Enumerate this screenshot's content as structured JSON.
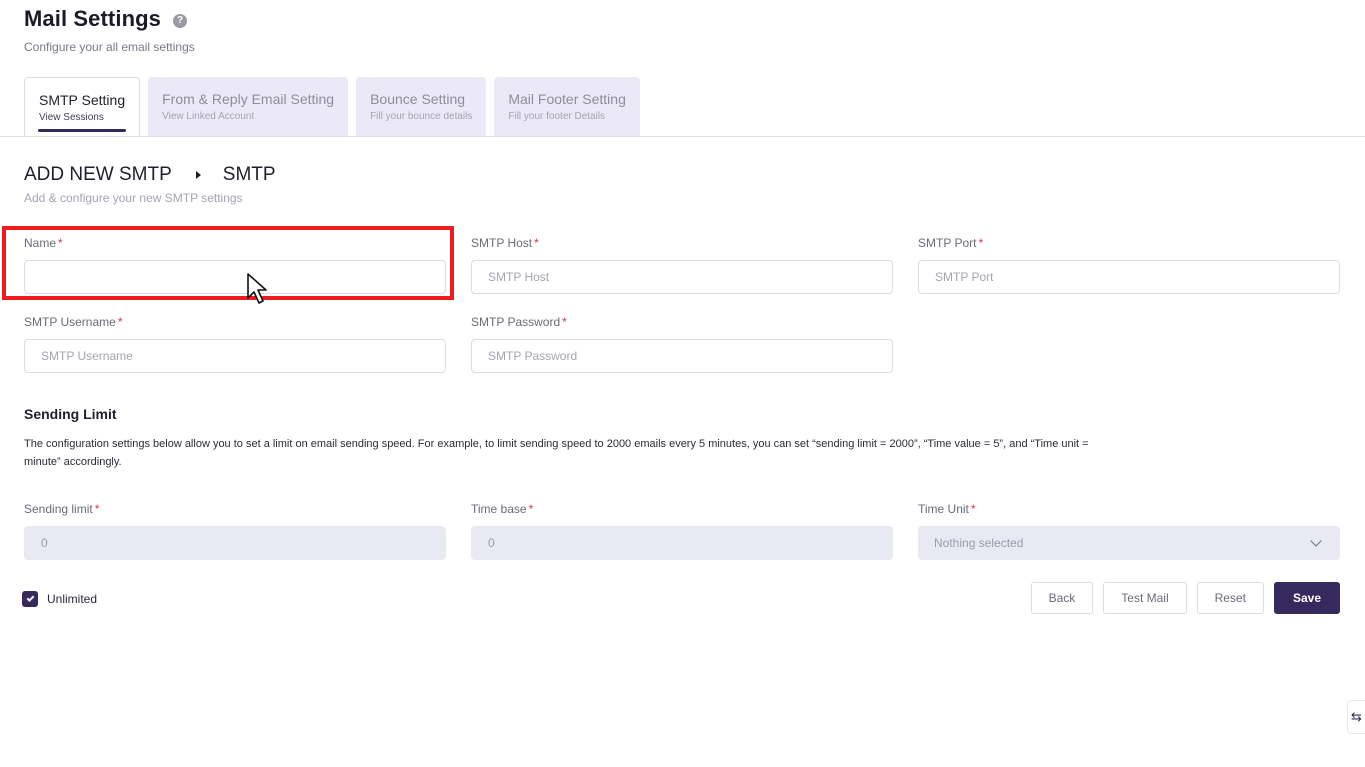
{
  "header": {
    "title": "Mail Settings",
    "help_icon": "?",
    "subtitle": "Configure your all email settings"
  },
  "tabs": [
    {
      "label": "SMTP Setting",
      "sub": "View Sessions",
      "active": true
    },
    {
      "label": "From & Reply Email Setting",
      "sub": "View Linked Account",
      "active": false
    },
    {
      "label": "Bounce Setting",
      "sub": "Fill your bounce details",
      "active": false
    },
    {
      "label": "Mail Footer Setting",
      "sub": "Fill your footer Details",
      "active": false
    }
  ],
  "section": {
    "crumb_1": "ADD NEW SMTP",
    "crumb_2": "SMTP",
    "subtitle": "Add & configure your new SMTP settings"
  },
  "form": {
    "name": {
      "label": "Name",
      "value": "",
      "placeholder": ""
    },
    "smtp_host": {
      "label": "SMTP Host",
      "value": "",
      "placeholder": "SMTP Host"
    },
    "smtp_port": {
      "label": "SMTP Port",
      "value": "",
      "placeholder": "SMTP Port"
    },
    "smtp_username": {
      "label": "SMTP Username",
      "value": "",
      "placeholder": "SMTP Username"
    },
    "smtp_password": {
      "label": "SMTP Password",
      "value": "",
      "placeholder": "SMTP Password"
    },
    "required_mark": "*"
  },
  "sending_limit": {
    "title": "Sending Limit",
    "description": "The configuration settings below allow you to set a limit on email sending speed. For example, to limit sending speed to 2000 emails every 5 minutes, you can set “sending limit = 2000”, “Time value = 5”, and “Time unit = minute” accordingly.",
    "limit": {
      "label": "Sending limit",
      "value": "0"
    },
    "time_base": {
      "label": "Time base",
      "value": "0"
    },
    "time_unit": {
      "label": "Time Unit",
      "value": "Nothing selected"
    },
    "unlimited": {
      "label": "Unlimited",
      "checked": true
    }
  },
  "buttons": {
    "back": "Back",
    "test_mail": "Test Mail",
    "reset": "Reset",
    "save": "Save"
  },
  "side_handle_glyph": "⇆",
  "colors": {
    "primary": "#35295e",
    "tab_inactive_bg": "#ece9f7",
    "required": "#e0324b",
    "highlight": "#ee1c1c",
    "disabled_input_bg": "#e8e9f3"
  }
}
